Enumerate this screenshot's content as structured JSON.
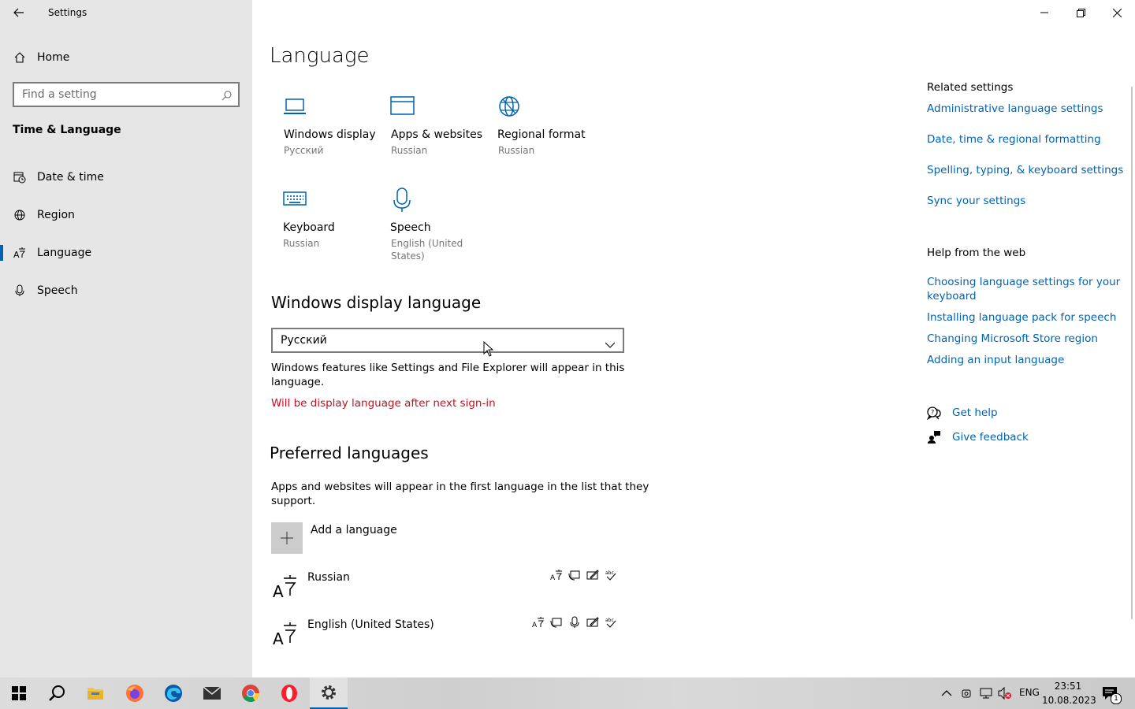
{
  "window": {
    "title": "Settings",
    "back_icon": "back-arrow-icon",
    "controls": [
      "minimize-icon",
      "maximize-icon",
      "close-icon"
    ]
  },
  "sidebar": {
    "home": "Home",
    "search": {
      "placeholder": "Find a setting"
    },
    "section": "Time & Language",
    "items": [
      {
        "label": "Date & time",
        "icon": "calendar-clock-icon"
      },
      {
        "label": "Region",
        "icon": "globe-icon"
      },
      {
        "label": "Language",
        "icon": "language-icon",
        "active": true
      },
      {
        "label": "Speech",
        "icon": "microphone-icon"
      }
    ]
  },
  "main": {
    "title": "Language",
    "tiles": [
      {
        "title": "Windows display",
        "sub": "Русский",
        "icon": "laptop-icon"
      },
      {
        "title": "Apps & websites",
        "sub": "Russian",
        "icon": "browser-window-icon"
      },
      {
        "title": "Regional format",
        "sub": "Russian",
        "icon": "globe-icon"
      },
      {
        "title": "Keyboard",
        "sub": "Russian",
        "icon": "keyboard-icon"
      },
      {
        "title": "Speech",
        "sub1": "English (United",
        "sub2": "States)",
        "icon": "microphone-icon"
      }
    ],
    "display_language": {
      "heading": "Windows display language",
      "selected": "Русский",
      "desc1": "Windows features like Settings and File Explorer will appear in this",
      "desc2": "language.",
      "warning": "Will be display language after next sign-in",
      "warning_color": "#c50f1f"
    },
    "preferred": {
      "heading": "Preferred languages",
      "desc1": "Apps and websites will appear in the first language in the list that they",
      "desc2": "support.",
      "add_label": "Add a language",
      "languages": [
        {
          "name": "Russian",
          "features": [
            "display-language-icon",
            "text-to-speech-icon",
            "handwriting-icon",
            "spellcheck-icon"
          ]
        },
        {
          "name": "English (United States)",
          "features": [
            "display-language-icon",
            "text-to-speech-icon",
            "speech-recognition-icon",
            "handwriting-icon",
            "spellcheck-icon"
          ]
        }
      ]
    }
  },
  "related": {
    "heading": "Related settings",
    "links": [
      "Administrative language settings",
      "Date, time & regional formatting",
      "Spelling, typing, & keyboard settings",
      "Sync your settings"
    ],
    "help_heading": "Help from the web",
    "help_links": [
      {
        "line1": "Choosing language settings for your",
        "line2": "keyboard"
      },
      {
        "line1": "Installing language pack for speech"
      },
      {
        "line1": "Changing Microsoft Store region"
      },
      {
        "line1": "Adding an input language"
      }
    ],
    "get_help": "Get help",
    "give_feedback": "Give feedback"
  },
  "taskbar": {
    "apps": [
      "windows-start-icon",
      "search-icon",
      "file-explorer-icon",
      "firefox-icon",
      "edge-icon",
      "mail-icon",
      "chrome-icon",
      "opera-icon",
      "settings-gear-icon"
    ],
    "tray": {
      "lang": "ENG",
      "time": "23:51",
      "date": "10.08.2023",
      "notifications": "1"
    }
  },
  "colors": {
    "accent": "#0063b1",
    "sidebar_bg": "#e6e6e6"
  }
}
